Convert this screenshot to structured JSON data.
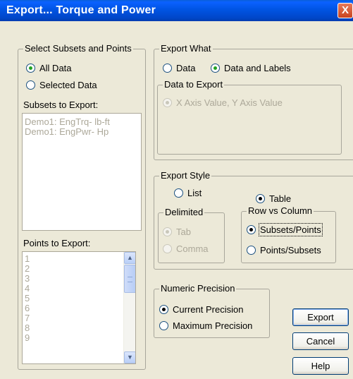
{
  "window": {
    "title": "Export... Torque and Power",
    "close_glyph": "X"
  },
  "subsets_points": {
    "legend": "Select Subsets and Points",
    "all_data": "All Data",
    "selected_data": "Selected Data",
    "selected": "all_data",
    "subsets_label": "Subsets to Export:",
    "subsets": [
      "Demo1: EngTrq- lb-ft",
      "Demo1: EngPwr- Hp"
    ],
    "points_label": "Points to Export:",
    "points": [
      "1",
      "2",
      "3",
      "4",
      "5",
      "6",
      "7",
      "8",
      "9"
    ]
  },
  "export_what": {
    "legend": "Export What",
    "data_label": "Data",
    "data_labels_label": "Data and Labels",
    "selected": "data_and_labels",
    "data_to_export": {
      "legend": "Data to Export",
      "option": "X Axis Value, Y Axis Value"
    }
  },
  "export_style": {
    "legend": "Export Style",
    "list_label": "List",
    "table_label": "Table",
    "selected": "table",
    "delimited": {
      "legend": "Delimited",
      "tab": "Tab",
      "comma": "Comma"
    },
    "row_vs_column": {
      "legend": "Row vs Column",
      "subsets_points": "Subsets/Points",
      "points_subsets": "Points/Subsets",
      "selected": "subsets_points"
    }
  },
  "numeric_precision": {
    "legend": "Numeric Precision",
    "current": "Current Precision",
    "maximum": "Maximum Precision",
    "selected": "current"
  },
  "buttons": {
    "export": "Export",
    "cancel": "Cancel",
    "help": "Help"
  },
  "icons": {
    "scroll_up": "scroll-up-arrow-icon",
    "scroll_down": "scroll-down-arrow-icon"
  }
}
